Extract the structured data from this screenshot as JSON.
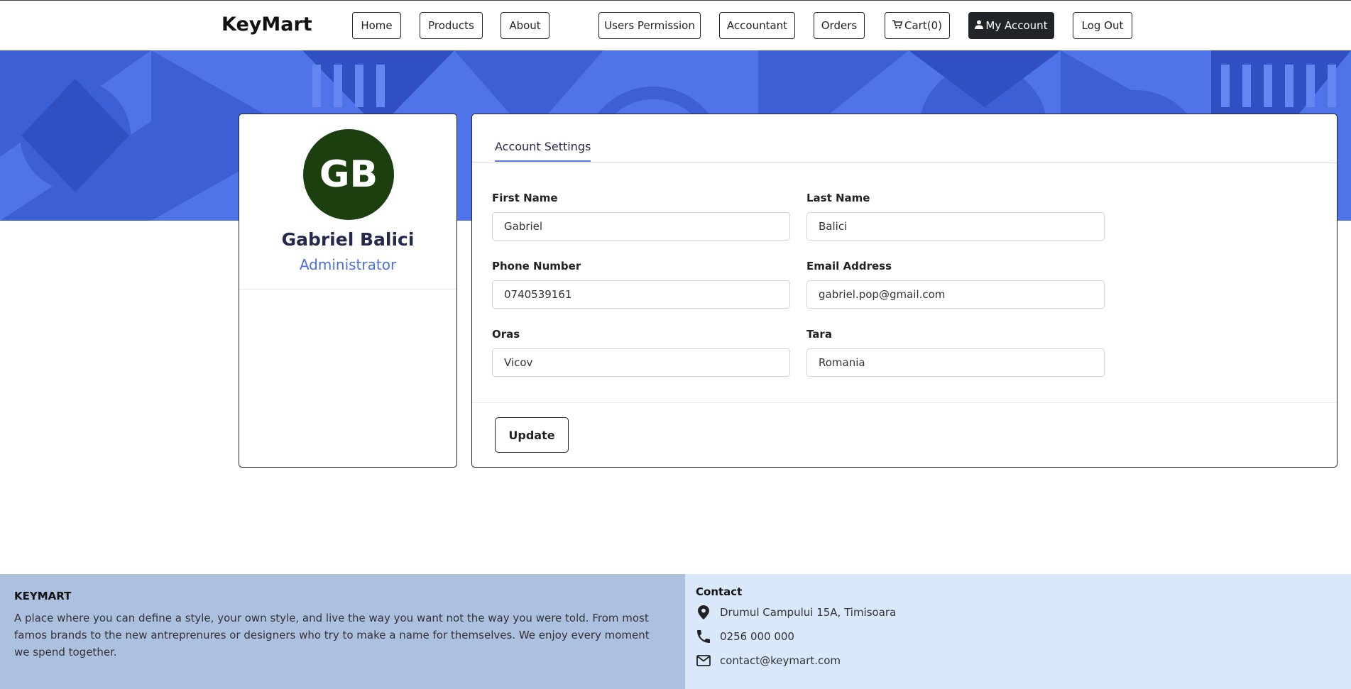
{
  "navbar": {
    "brand": "KeyMart",
    "items": [
      {
        "label": "Home"
      },
      {
        "label": "Products"
      },
      {
        "label": "About"
      },
      {
        "label": "Users Permission"
      },
      {
        "label": "Accountant"
      },
      {
        "label": "Orders"
      },
      {
        "label": "Cart(0)",
        "icon": "cart-icon"
      },
      {
        "label": "My Account",
        "icon": "user-icon",
        "active": true
      },
      {
        "label": "Log Out"
      }
    ]
  },
  "profile": {
    "initials": "GB",
    "name": "Gabriel Balici",
    "role": "Administrator",
    "avatar_color": "#1b3f0f"
  },
  "settings": {
    "tab_label": "Account Settings",
    "fields": {
      "first_name": {
        "label": "First Name",
        "value": "Gabriel"
      },
      "last_name": {
        "label": "Last Name",
        "value": "Balici"
      },
      "phone": {
        "label": "Phone Number",
        "value": "0740539161"
      },
      "email": {
        "label": "Email Address",
        "value": "gabriel.pop@gmail.com"
      },
      "city": {
        "label": "Oras",
        "value": "Vicov"
      },
      "country": {
        "label": "Tara",
        "value": "Romania"
      }
    },
    "update_label": "Update"
  },
  "footer": {
    "title": "KEYMART",
    "description": "A place where you can define a style, your own style, and live the way you want not the way you were told. From most famos brands to the new antreprenures or designers who try to make a name for themselves. We enjoy every moment we spend together.",
    "contact_title": "Contact",
    "address": "Drumul Campului 15A, Timisoara",
    "phone": "0256 000 000",
    "email": "contact@keymart.com"
  },
  "colors": {
    "banner": "#4f73e8",
    "accent": "#4f6fd8",
    "footer_left": "#abc1df",
    "footer_right": "#d9e8fb"
  }
}
